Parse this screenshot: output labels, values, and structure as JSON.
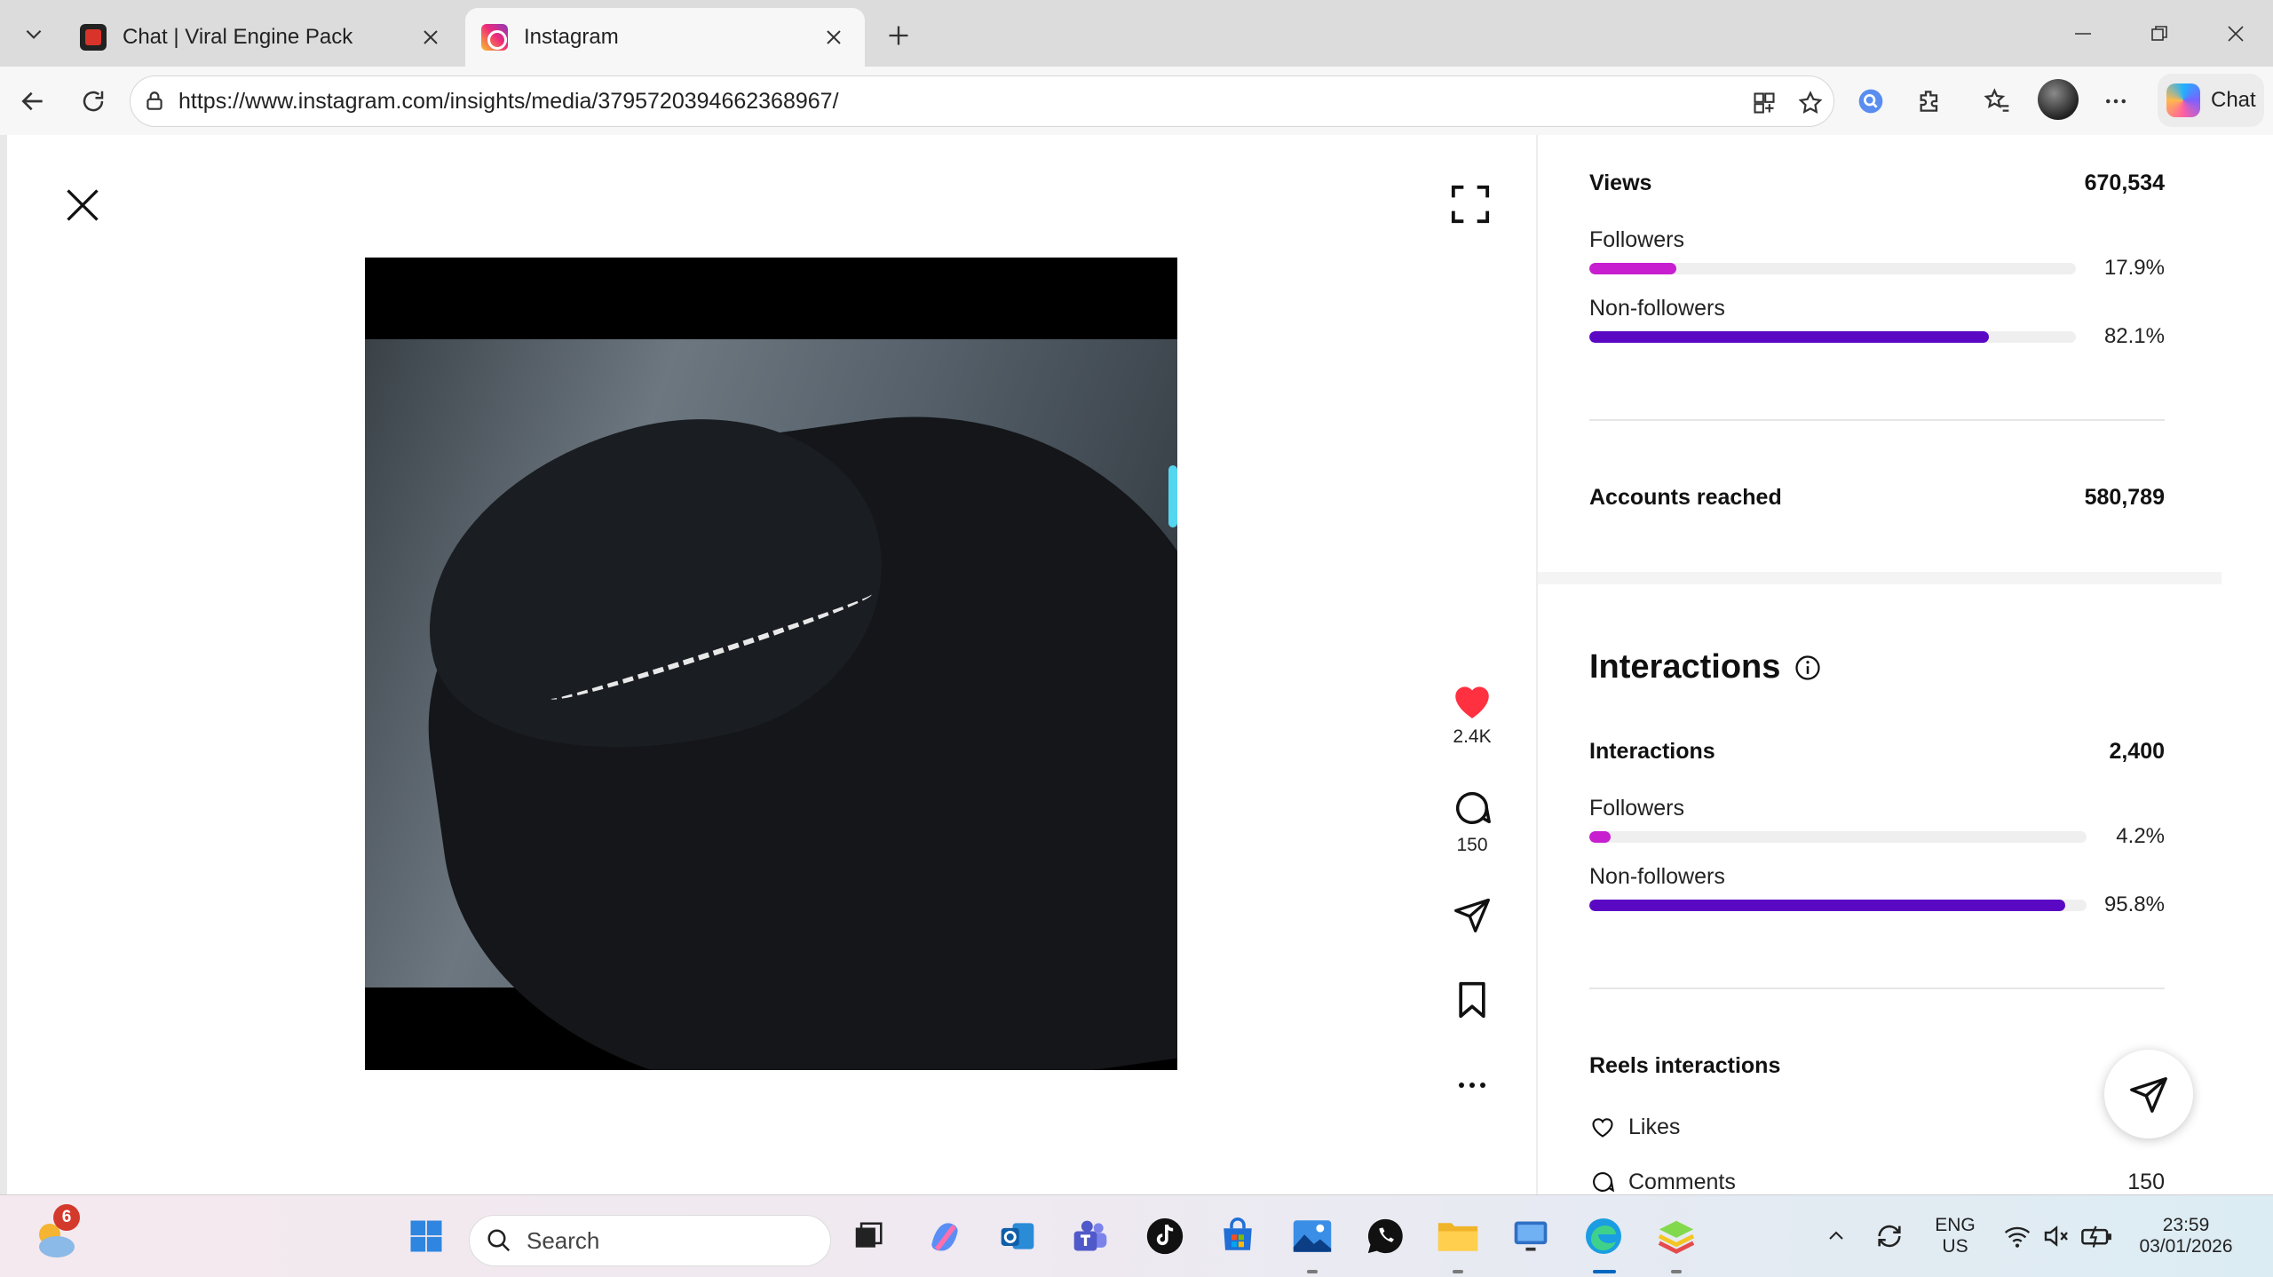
{
  "browser": {
    "tabs": [
      {
        "title": "Chat | Viral Engine Pack",
        "active": false
      },
      {
        "title": "Instagram",
        "active": true
      }
    ],
    "url": "https://www.instagram.com/insights/media/3795720394662368967/",
    "chat_label": "Chat"
  },
  "post": {
    "likes": "2.4K",
    "comments": "150"
  },
  "insights": {
    "views": {
      "label": "Views",
      "value": "670,534"
    },
    "views_followers": {
      "label": "Followers",
      "pct": "17.9%",
      "fraction": 0.179
    },
    "views_nonfollowers": {
      "label": "Non-followers",
      "pct": "82.1%",
      "fraction": 0.821
    },
    "accounts_reached": {
      "label": "Accounts reached",
      "value": "580,789"
    },
    "interactions_title": "Interactions",
    "interactions": {
      "label": "Interactions",
      "value": "2,400"
    },
    "int_followers": {
      "label": "Followers",
      "pct": "4.2%",
      "fraction": 0.042
    },
    "int_nonfollowers": {
      "label": "Non-followers",
      "pct": "95.8%",
      "fraction": 0.958
    },
    "reels_interactions": {
      "label": "Reels interactions"
    },
    "likes": {
      "label": "Likes",
      "value": ""
    },
    "comments": {
      "label": "Comments",
      "value": "150"
    },
    "colors": {
      "followers": "#c71ed0",
      "nonfollowers": "#5a08c4",
      "track": "#efefef"
    }
  },
  "taskbar": {
    "weather_badge": "6",
    "search_placeholder": "Search",
    "language": "ENG",
    "region": "US",
    "time": "23:59",
    "date": "03/01/2026"
  }
}
